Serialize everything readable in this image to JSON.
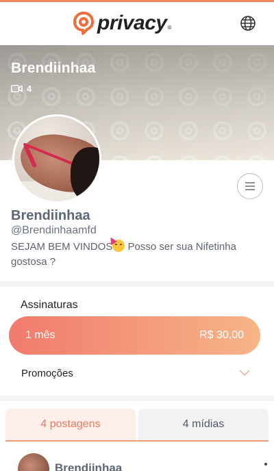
{
  "header": {
    "logo_text": "privacy",
    "logo_reg": "®",
    "brand_color": "#f26b3a",
    "globe_icon": "globe-icon"
  },
  "cover": {
    "name": "Brendiinhaa",
    "video_count": "4",
    "video_icon": "video-camera-icon"
  },
  "profile": {
    "name": "Brendiinhaa",
    "handle": "@Brendinhaamfd",
    "bio_part1": "SEJAM BEM VINDOS",
    "bio_emoji": "partying-face-emoji",
    "bio_part2": " Posso ser sua Nifetinha gostosa ?",
    "menu_icon": "hamburger-menu-icon"
  },
  "subscriptions": {
    "title": "Assinaturas",
    "plan_label": "1 mês",
    "plan_price": "R$ 30,00",
    "accent_from": "#f17a6c",
    "accent_to": "#f7b587"
  },
  "promotions": {
    "label": "Promoções",
    "chevron_icon": "chevron-down-icon"
  },
  "tabs": [
    {
      "label": "4 postagens",
      "active": true
    },
    {
      "label": "4 mídias",
      "active": false
    }
  ],
  "post": {
    "author": "Brendiinhaa"
  }
}
